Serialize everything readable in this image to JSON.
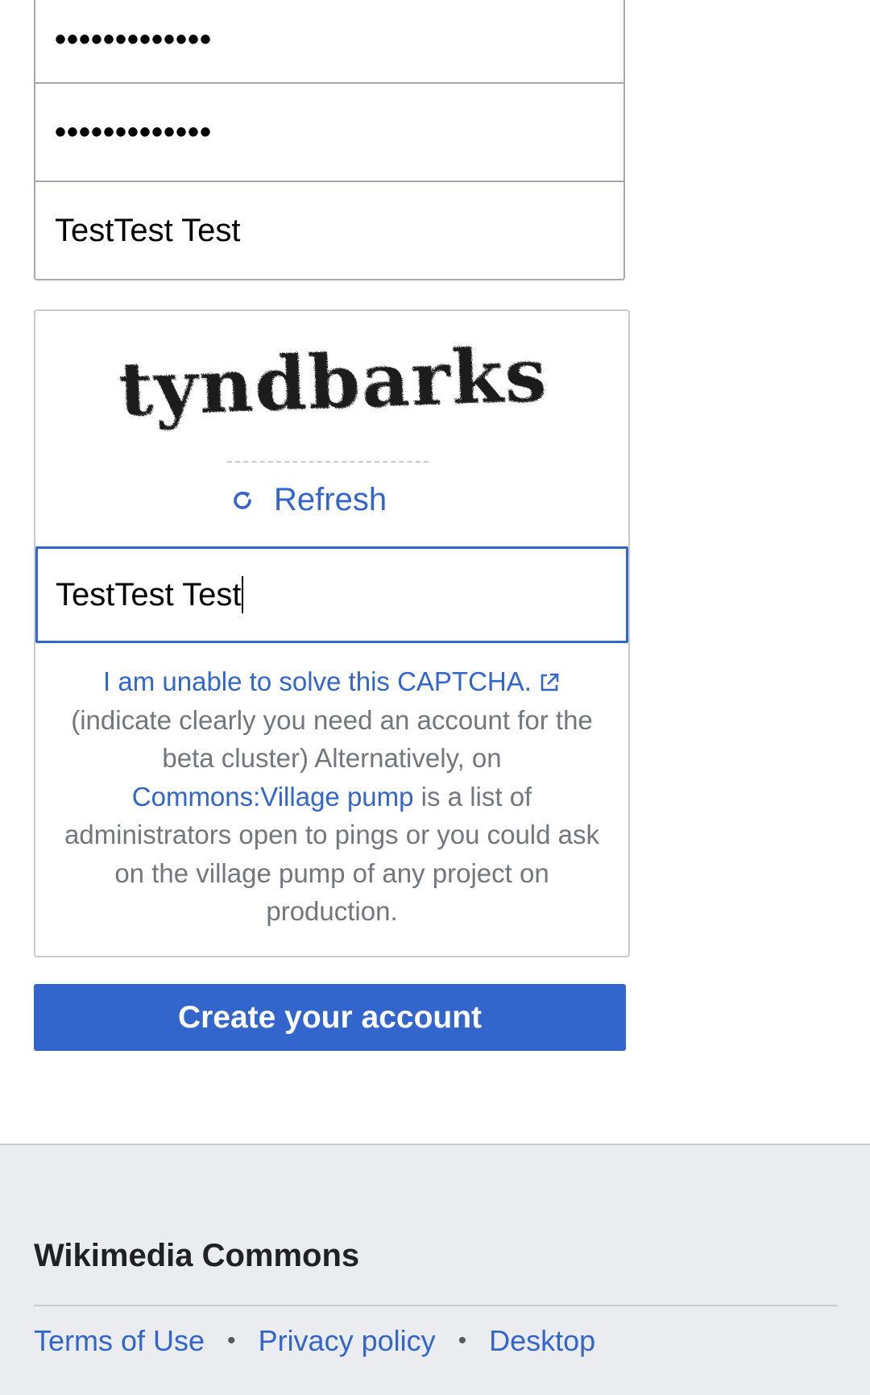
{
  "form": {
    "password_value": "•••••••••••••",
    "confirm_password_value": "•••••••••••••",
    "name_value": "TestTest Test"
  },
  "captcha": {
    "image_text": "tyndbarks",
    "refresh_label": "Refresh",
    "input_value": "TestTest Test",
    "help": {
      "unable_link": "I am unable to solve this CAPTCHA.",
      "text_1": "(indicate clearly you need an account for the beta cluster) Alternatively, on",
      "village_pump_link": "Commons:Village pump",
      "text_2": "is a list of administrators open to pings or you could ask on the village pump of any project on production."
    }
  },
  "submit": {
    "label": "Create your account"
  },
  "footer": {
    "site_name": "Wikimedia Commons",
    "links": [
      "Terms of Use",
      "Privacy policy",
      "Desktop"
    ],
    "separator": "•"
  },
  "colors": {
    "link": "#3366cc",
    "button_bg": "#3366cc",
    "border": "#a2a9b1",
    "footer_bg": "#eaecf0",
    "muted_text": "#72777d"
  }
}
